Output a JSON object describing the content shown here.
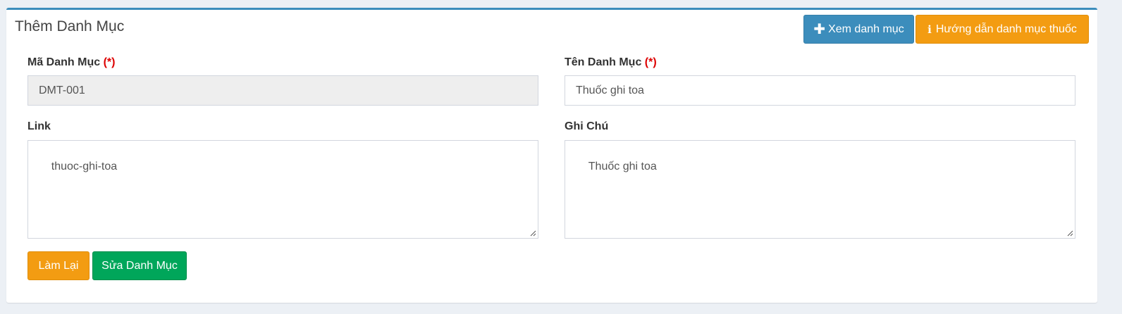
{
  "panel": {
    "title": "Thêm Danh Mục"
  },
  "header_buttons": {
    "view_label": "Xem danh mục",
    "view_icon": "plus-icon",
    "guide_label": "Hướng dẫn danh mục thuốc",
    "guide_icon": "info-icon"
  },
  "form": {
    "code": {
      "label": "Mã Danh Mục",
      "required_marker": "(*)",
      "value": "DMT-001"
    },
    "name": {
      "label": "Tên Danh Mục",
      "required_marker": "(*)",
      "value": "Thuốc ghi toa"
    },
    "link": {
      "label": "Link",
      "value": "thuoc-ghi-toa"
    },
    "note": {
      "label": "Ghi Chú",
      "value": "Thuốc ghi toa"
    }
  },
  "actions": {
    "reset_label": "Làm Lại",
    "save_label": "Sửa Danh Mục"
  },
  "colors": {
    "primary": "#3c8dbc",
    "warning": "#f39c12",
    "success": "#00a65a",
    "required": "#dd0000"
  }
}
